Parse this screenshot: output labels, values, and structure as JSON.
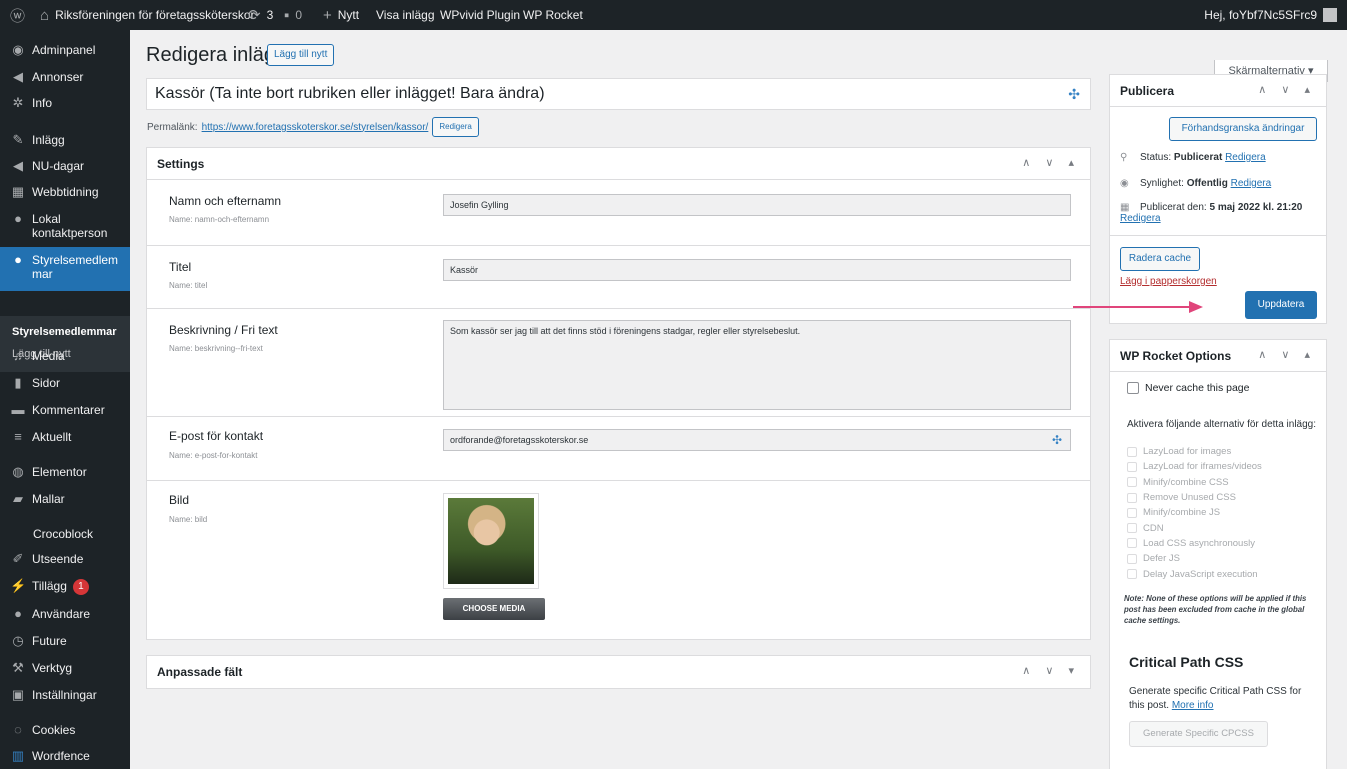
{
  "adminbar": {
    "site_name": "Riksföreningen för företagssköterskor",
    "updates_count": "3",
    "comments_count": "0",
    "new_label": "Nytt",
    "view_post": "Visa inlägg",
    "plugin1": "WPvivid Plugin",
    "plugin2": "WP Rocket",
    "greeting": "Hej, foYbf7Nc5SFrc9"
  },
  "sidebar": {
    "items": [
      {
        "label": "Adminpanel",
        "icon": "gauge-icon"
      },
      {
        "label": "Annonser",
        "icon": "megaphone-icon"
      },
      {
        "label": "Info",
        "icon": "gear-icon"
      },
      {
        "label": "Inlägg",
        "icon": "pin-icon"
      },
      {
        "label": "NU-dagar",
        "icon": "megaphone-icon"
      },
      {
        "label": "Webbtidning",
        "icon": "layout-icon"
      },
      {
        "label": "Lokal kontaktperson",
        "icon": "user-icon"
      },
      {
        "label": "Styrelsemedlem mar",
        "icon": "user-icon"
      },
      {
        "label": "Media",
        "icon": "media-icon"
      },
      {
        "label": "Sidor",
        "icon": "page-icon"
      },
      {
        "label": "Kommentarer",
        "icon": "comment-icon"
      },
      {
        "label": "Aktuellt",
        "icon": "menu-icon"
      },
      {
        "label": "Elementor",
        "icon": "elementor-icon"
      },
      {
        "label": "Mallar",
        "icon": "folder-icon"
      },
      {
        "label": "Crocoblock",
        "icon": ""
      },
      {
        "label": "Utseende",
        "icon": "brush-icon"
      },
      {
        "label": "Tillägg",
        "icon": "plugin-icon"
      },
      {
        "label": "Användare",
        "icon": "user-icon"
      },
      {
        "label": "Future",
        "icon": "clock-icon"
      },
      {
        "label": "Verktyg",
        "icon": "wrench-icon"
      },
      {
        "label": "Inställningar",
        "icon": "settings-icon"
      },
      {
        "label": "Cookies",
        "icon": "cookie-icon"
      },
      {
        "label": "Wordfence",
        "icon": "shield-icon"
      }
    ],
    "submenu": {
      "current": "Styrelsemedlemmar",
      "add_new": "Lägg till nytt"
    },
    "plugin_badge": "1"
  },
  "page": {
    "title": "Redigera inlägg",
    "add_new": "Lägg till nytt",
    "screen_options": "Skärmalternativ ▾",
    "post_title": "Kassör (Ta inte bort rubriken eller inlägget! Bara ändra)",
    "permalink_label": "Permalänk:",
    "permalink_url": "https://www.foretagsskoterskor.se/styrelsen/kassor/",
    "permalink_edit": "Redigera"
  },
  "settings": {
    "title": "Settings",
    "fields": [
      {
        "label": "Namn och efternamn",
        "name": "Name: namn-och-efternamn",
        "value": "Josefin Gylling"
      },
      {
        "label": "Titel",
        "name": "Name: titel",
        "value": "Kassör"
      },
      {
        "label": "Beskrivning / Fri text",
        "name": "Name: beskrivning--fri-text",
        "value": "Som kassör ser jag till att det finns stöd i föreningens stadgar, regler eller styrelsebeslut."
      },
      {
        "label": "E-post för kontakt",
        "name": "Name: e-post-for-kontakt",
        "value": "ordforande@foretagsskoterskor.se"
      },
      {
        "label": "Bild",
        "name": "Name: bild",
        "value": ""
      }
    ],
    "choose_media": "CHOOSE MEDIA"
  },
  "custom_fields": {
    "title": "Anpassade fält"
  },
  "publish": {
    "title": "Publicera",
    "preview": "Förhandsgranska ändringar",
    "status_label": "Status:",
    "status_value": "Publicerat",
    "visibility_label": "Synlighet:",
    "visibility_value": "Offentlig",
    "published_label": "Publicerat den:",
    "published_value": "5 maj 2022 kl. 21:20",
    "edit": "Redigera",
    "clear_cache": "Radera cache",
    "trash": "Lägg i papperskorgen",
    "update": "Uppdatera"
  },
  "rocket": {
    "title": "WP Rocket Options",
    "never_cache": "Never cache this page",
    "activate_text": "Aktivera följande alternativ för detta inlägg:",
    "options": [
      "LazyLoad for images",
      "LazyLoad for iframes/videos",
      "Minify/combine CSS",
      "Remove Unused CSS",
      "Minify/combine JS",
      "CDN",
      "Load CSS asynchronously",
      "Defer JS",
      "Delay JavaScript execution"
    ],
    "note": "Note: None of these options will be applied if this post has been excluded from cache in the global cache settings.",
    "cpcss_title": "Critical Path CSS",
    "cpcss_desc": "Generate specific Critical Path CSS for this post.",
    "more_info": "More info",
    "generate": "Generate Specific CPCSS"
  },
  "colors": {
    "accent": "#2271b1",
    "admin_bar": "#1d2327",
    "arrow": "#e0457b",
    "danger": "#d63638"
  }
}
